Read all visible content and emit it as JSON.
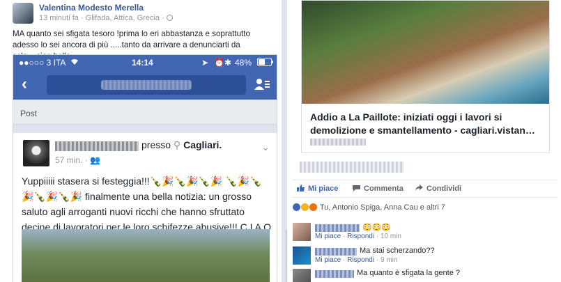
{
  "left_post": {
    "author": "Valentina Modesto Merella",
    "meta": "13 minuti fa · Glifada, Attica, Grecia ·",
    "text": "MA quanto sei sfigata tesoro !prima lo eri abbastanza e soprattutto adesso lo sei ancora di più .....tanto da arrivare a denunciarti da sola....ciao bella"
  },
  "embedded_screenshot": {
    "status_bar": {
      "carrier": "●●○○○ 3 ITA",
      "time": "14:14",
      "battery": "48%"
    },
    "post_label": "Post",
    "inner_post": {
      "presso": "presso",
      "location": "Cagliari.",
      "time": "57 min. ·",
      "text": "Yuppiiiii stasera si festeggia!!!🍾🎉🍾🎉🍾🎉 🍾🎉🍾🎉🍾🎉🍾🎉 finalmente una bella notizia: un grosso saluto agli arroganti nuovi ricchi che hanno sfruttato decine di lavoratori per le loro schifezze abusive!!! C I A O   B E L L I 👏🏻👏🏻👏🏻👏🏻👏🏻"
    }
  },
  "right_post": {
    "link_title": "Addio a La Paillote: iniziati oggi i lavori si demolizione e smantellamento - cagliari.vistan…",
    "actions": {
      "like": "Mi piace",
      "comment": "Commenta",
      "share": "Condividi"
    },
    "reactions_text": "Tu, Antonio Spiga, Anna Cau e altri 7",
    "comments": [
      {
        "text": "😳😳😳",
        "meta_like": "Mi piace",
        "meta_reply": "Rispondi",
        "meta_time": "10 min"
      },
      {
        "text": "Ma stai scherzando??",
        "meta_like": "Mi piace",
        "meta_reply": "Rispondi",
        "meta_time": "9 min"
      },
      {
        "text": "Ma quanto è sfigata la gente ?",
        "meta_like": "",
        "meta_reply": "",
        "meta_time": ""
      }
    ]
  },
  "colors": {
    "facebook_blue": "#4267b2",
    "link_blue": "#365899",
    "meta_gray": "#90949c"
  }
}
